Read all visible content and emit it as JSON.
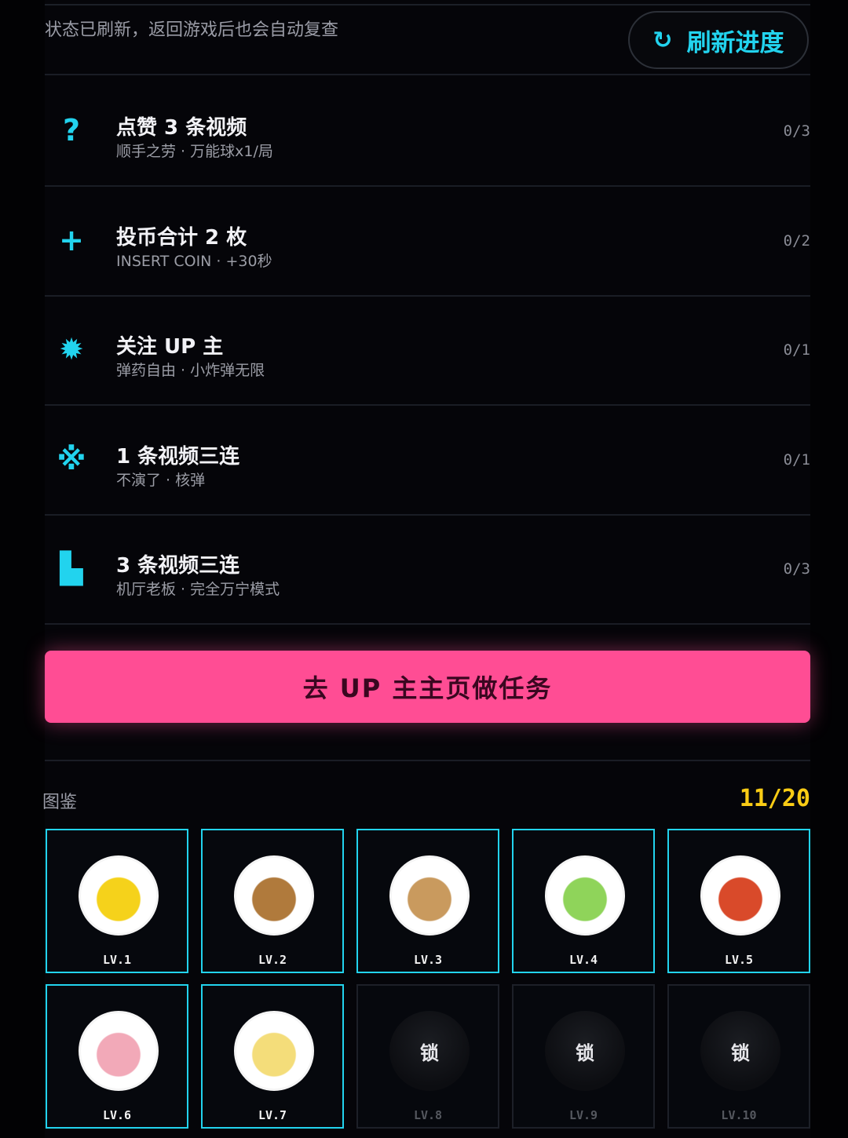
{
  "header": {
    "status_text": "状态已刷新，返回游戏后也会自动复查",
    "refresh_icon": "refresh-icon",
    "refresh_label": "刷新进度"
  },
  "tasks": [
    {
      "icon": "question-icon",
      "glyph": "?",
      "title": "点赞 3 条视频",
      "subtitle": "顺手之劳 · 万能球x1/局",
      "progress": "0/3"
    },
    {
      "icon": "plus-icon",
      "glyph": "+",
      "title": "投币合计 2 枚",
      "subtitle": "INSERT COIN · +30秒",
      "progress": "0/2"
    },
    {
      "icon": "starburst-icon",
      "glyph": "✹",
      "title": "关注 UP 主",
      "subtitle": "弹药自由 · 小炸弹无限",
      "progress": "0/1"
    },
    {
      "icon": "cross-icon",
      "glyph": "※",
      "title": "1 条视频三连",
      "subtitle": "不演了 · 核弹",
      "progress": "0/1"
    },
    {
      "icon": "bookmark-icon",
      "glyph": "▙",
      "title": "3 条视频三连",
      "subtitle": "机厅老板 · 完全万宁模式",
      "progress": "0/3"
    }
  ],
  "cta": {
    "label": "去 UP 主主页做任务"
  },
  "gallery": {
    "label": "图鉴",
    "count": "11/20",
    "lock_label": "锁",
    "items": [
      {
        "level": "LV.1",
        "locked": false,
        "avatar": "banana-cat-avatar",
        "color": "#f5d21b"
      },
      {
        "level": "LV.2",
        "locked": false,
        "avatar": "dog-avatar",
        "color": "#b07a3c"
      },
      {
        "level": "LV.3",
        "locked": false,
        "avatar": "cat-avatar",
        "color": "#c99a5e"
      },
      {
        "level": "LV.4",
        "locked": false,
        "avatar": "chicken-avatar",
        "color": "#8fd45a"
      },
      {
        "level": "LV.5",
        "locked": false,
        "avatar": "pixel-character-avatar",
        "color": "#d94a2a"
      },
      {
        "level": "LV.6",
        "locked": false,
        "avatar": "anime-girl-avatar",
        "color": "#f2a9b8"
      },
      {
        "level": "LV.7",
        "locked": false,
        "avatar": "duck-avatar",
        "color": "#f4dd7a"
      },
      {
        "level": "LV.8",
        "locked": true,
        "avatar": "locked-avatar"
      },
      {
        "level": "LV.9",
        "locked": true,
        "avatar": "locked-avatar"
      },
      {
        "level": "LV.10",
        "locked": true,
        "avatar": "locked-avatar"
      }
    ]
  }
}
